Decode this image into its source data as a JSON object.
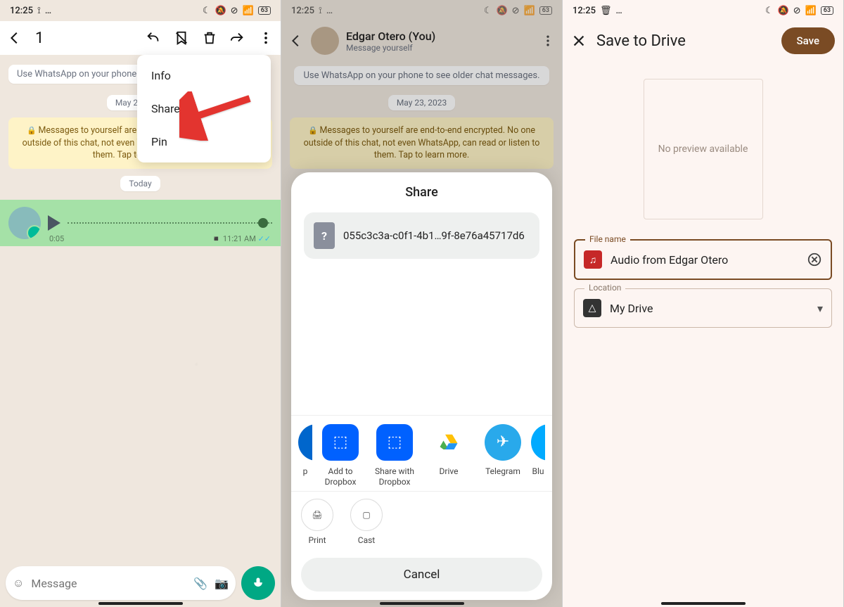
{
  "status": {
    "time": "12:25",
    "battery": "63"
  },
  "panel1": {
    "selected_count": "1",
    "older_msg": "Use WhatsApp on your phone to see older chat messages.",
    "date1": "May 23, 2023",
    "encryption": "Messages to yourself are end-to-end encrypted. No one outside of this chat, not even WhatsApp, can read or listen to them. Tap to learn more.",
    "date2": "Today",
    "voice": {
      "duration": "0:05",
      "time": "11:21 AM"
    },
    "menu": {
      "info": "Info",
      "share": "Share",
      "pin": "Pin"
    },
    "composer_placeholder": "Message"
  },
  "panel2": {
    "contact_name": "Edgar Otero (You)",
    "contact_sub": "Message yourself",
    "older_msg": "Use WhatsApp on your phone to see older chat messages.",
    "date1": "May 23, 2023",
    "encryption": "Messages to yourself are end-to-end encrypted. No one outside of this chat, not even WhatsApp, can read or listen to them. Tap to learn more.",
    "sheet_title": "Share",
    "filename": "055c3c3a-c0f1-4b1…9f-8e76a45717d6",
    "apps": {
      "left_cut": "p",
      "dropbox_add": "Add to Dropbox",
      "dropbox_share": "Share with Dropbox",
      "drive": "Drive",
      "telegram": "Telegram",
      "right_cut": "Blu"
    },
    "actions": {
      "print": "Print",
      "cast": "Cast"
    },
    "cancel": "Cancel"
  },
  "panel3": {
    "title": "Save to Drive",
    "save": "Save",
    "preview": "No preview available",
    "filename_label": "File name",
    "filename_value": "Audio from Edgar Otero",
    "location_label": "Location",
    "location_value": "My Drive"
  }
}
